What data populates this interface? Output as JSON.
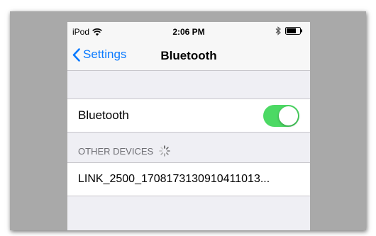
{
  "status_bar": {
    "carrier": "iPod",
    "time": "2:06 PM"
  },
  "nav": {
    "back_label": "Settings",
    "title": "Bluetooth"
  },
  "bluetooth_row": {
    "label": "Bluetooth",
    "toggle_on": true
  },
  "other_devices": {
    "header": "OTHER DEVICES",
    "items": [
      {
        "label": "LINK_2500_1708173130910411013..."
      }
    ]
  },
  "colors": {
    "accent": "#0a7aff",
    "toggle_on": "#4cd964",
    "background": "#efeff4",
    "frame": "#a9a9a9"
  }
}
